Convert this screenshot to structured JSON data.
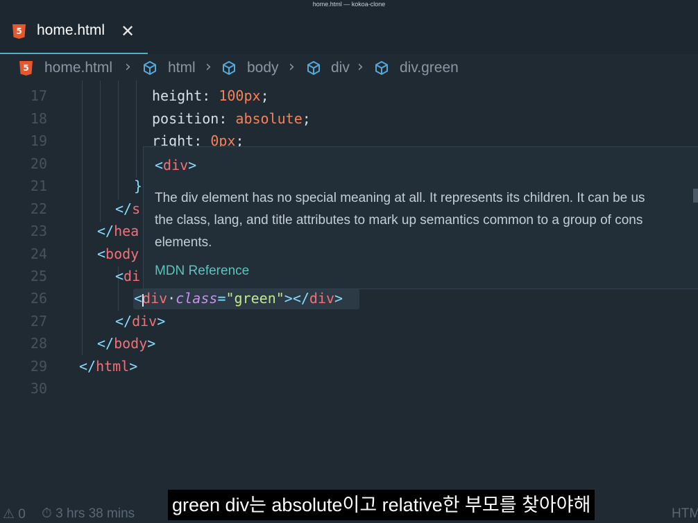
{
  "window": {
    "title": "home.html — kokoa-clone"
  },
  "tab": {
    "label": "home.html",
    "icon_text": "5",
    "close": "✕"
  },
  "breadcrumb": {
    "file": "home.html",
    "items": [
      "html",
      "body",
      "div",
      "div.green"
    ],
    "separator": "›"
  },
  "editor": {
    "line_numbers": [
      "17",
      "18",
      "19",
      "20",
      "21",
      "22",
      "23",
      "24",
      "25",
      "26",
      "27",
      "28",
      "29",
      "30"
    ],
    "code": {
      "l17_prop": "height",
      "l17_colon": ": ",
      "l17_val": "100px",
      "l17_semi": ";",
      "l18_prop": "position",
      "l18_colon": ": ",
      "l18_val": "absolute",
      "l18_semi": ";",
      "l19_prop": "right",
      "l19_colon": ": ",
      "l19_val": "0px",
      "l19_semi": ";",
      "l21": "}",
      "l22_open": "</",
      "l22_tag": "s",
      "l23_open": "</",
      "l23_tag": "hea",
      "l24_open": "<",
      "l24_tag": "body",
      "l25_open": "<",
      "l25_tag": "di",
      "l26_lt": "<",
      "l26_tag": "div",
      "l26_attr": "class",
      "l26_eq": "=",
      "l26_str": "\"green\"",
      "l26_gt": "></",
      "l26_close_tag": "div",
      "l26_end": ">",
      "l27_open": "</",
      "l27_tag": "div",
      "l27_end": ">",
      "l28_open": "</",
      "l28_tag": "body",
      "l28_end": ">",
      "l29_open": "</",
      "l29_tag": "html",
      "l29_end": ">"
    }
  },
  "hover": {
    "sig_open": "<",
    "sig_tag": "div",
    "sig_close": ">",
    "desc_lines": [
      "The div element has no special meaning at all. It represents its children. It can be us",
      "the class, lang, and title attributes to mark up semantics common to a group of cons",
      "elements."
    ],
    "link": "MDN Reference"
  },
  "status": {
    "left": "⚠ 0",
    "time": "⏱ 3 hrs 38 mins",
    "right": "HTM"
  },
  "subtitle": "green div는 absolute이고 relative한 부모를 찾아야해",
  "colors": {
    "accent": "#4fb0c6",
    "html5": "#e8562d",
    "tag": "#f07178",
    "string": "#c3e88d"
  }
}
